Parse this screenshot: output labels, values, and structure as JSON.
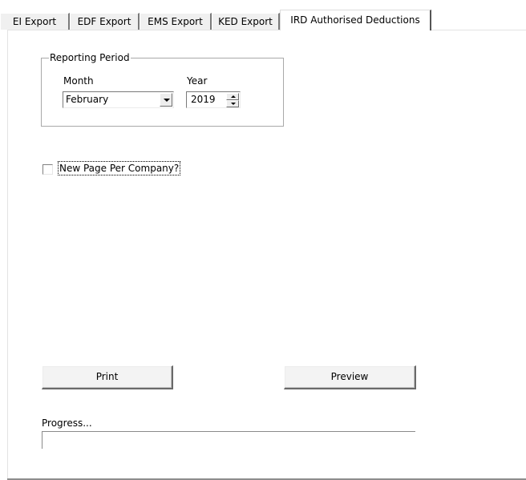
{
  "tabs": [
    {
      "label": "EI Export",
      "active": false
    },
    {
      "label": "EDF Export",
      "active": false
    },
    {
      "label": "EMS Export",
      "active": false
    },
    {
      "label": "KED Export",
      "active": false
    },
    {
      "label": "IRD Authorised Deductions",
      "active": true
    }
  ],
  "reporting_period": {
    "group_label": "Reporting Period",
    "month_label": "Month",
    "month_value": "February",
    "year_label": "Year",
    "year_value": "2019"
  },
  "options": {
    "new_page_per_company_label": "New Page Per Company?",
    "new_page_per_company_checked": false
  },
  "buttons": {
    "print_label": "Print",
    "preview_label": "Preview"
  },
  "progress": {
    "label": "Progress...",
    "value": 0
  }
}
